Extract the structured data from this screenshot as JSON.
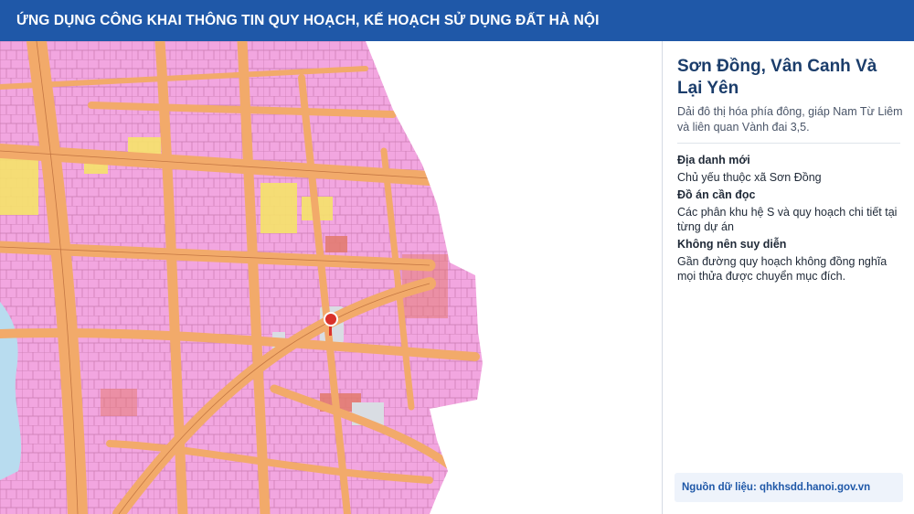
{
  "header": {
    "title": "ỨNG DỤNG CÔNG KHAI THÔNG TIN QUY HOẠCH, KẾ HOẠCH SỬ DỤNG ĐẤT HÀ NỘI"
  },
  "map": {
    "colors": {
      "residential": "#f2a6e0",
      "road": "#f2aa6a",
      "water": "#b8dcef",
      "yellow_zone": "#f6e36a",
      "public": "#e27a6a",
      "marker": "#d9322b"
    },
    "icons": {
      "marker": "map-pin-icon"
    }
  },
  "panel": {
    "title": "Sơn Đồng, Vân Canh Và Lại Yên",
    "description": "Dải đô thị hóa phía đông, giáp Nam Từ Liêm và liên quan Vành đai 3,5.",
    "sections": [
      {
        "label": "Địa danh mới",
        "text": "Chủ yếu thuộc xã Sơn Đồng"
      },
      {
        "label": "Đồ án cần đọc",
        "text": "Các phân khu hệ S và quy hoạch chi tiết tại từng dự án"
      },
      {
        "label": "Không nên suy diễn",
        "text": "Gần đường quy hoạch không đồng nghĩa mọi thửa được chuyển mục đích."
      }
    ],
    "source": "Nguồn dữ liệu: qhkhsdd.hanoi.gov.vn"
  }
}
